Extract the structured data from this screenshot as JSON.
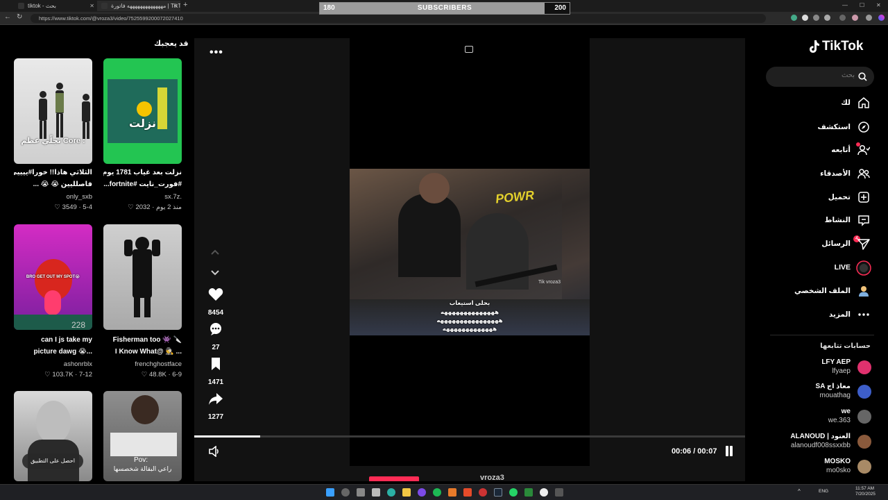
{
  "browser": {
    "tabs": [
      {
        "label": "tiktok - بحث"
      },
      {
        "label": "فاتورة‎ مهههههههههههههه‎ | TikTok"
      }
    ],
    "new_tab_icon": "+",
    "url": "https://www.tiktok.com/@vroza3/video/7525599200072027410",
    "window_controls": {
      "minimize": "—",
      "maximize": "☐",
      "close": "✕"
    }
  },
  "overlay": {
    "current": "180",
    "label": "SUBSCRIBERS",
    "goal": "200",
    "progress_fraction": 0.9
  },
  "recommended": {
    "title": "قد يعجبك",
    "cards": [
      {
        "thumb_text": "تجلّي عظم Core :",
        "caption1": "الثلاثي هاذا!! خورا#ييييي",
        "caption2": "فاصلليين 😭 😭 ...",
        "author": "only_sxb",
        "stats": "♡ 3549 · 5-4"
      },
      {
        "thumb_text": "نزلت",
        "caption1": "نزلت بعد غياب 1781 يوم 😍",
        "caption2": "#فورت_نايت #fortnite...",
        "author": "sx.7z.",
        "stats": "♡ 2032 · منذ 2 يوم"
      },
      {
        "thumb_text": "BRO GET OUT MY SPOT😭",
        "thumb_num": "228",
        "caption1": "can I js take my",
        "caption2": "picture dawg 😭...",
        "author": "ashonrblx",
        "stats": "♡ 103.7K · 7-12"
      },
      {
        "caption1": "Fisherman too 👾 🔪",
        "caption2": "I Know What@ 🕵️ ...",
        "author": "frenchghostface",
        "stats": "♡ 48.8K · 6-9"
      },
      {
        "thumb_text": "احصل على التطبيق"
      },
      {
        "thumb_text": "Pov:",
        "thumb_text2": "راعي البقالة شخصسها"
      }
    ]
  },
  "video": {
    "more_icon": "•••",
    "watermark": "Tik vroza3",
    "subtitle_lines": [
      "بحلى استيعاب",
      "ههههههههههههههه",
      "ههههههههههههههههه",
      "هههههههههههههه"
    ],
    "likes": "8454",
    "comments": "27",
    "saves": "1471",
    "shares": "1277",
    "time": "00:06 / 00:07",
    "progress_fraction": 0.12,
    "author_below": "vroza3"
  },
  "sidebar": {
    "logo": "TikTok",
    "search_placeholder": "بحث",
    "nav": [
      {
        "label": "لك",
        "icon": "home-icon"
      },
      {
        "label": "استكشف",
        "icon": "compass-icon"
      },
      {
        "label": "أتابعه",
        "icon": "following-icon"
      },
      {
        "label": "الأصدقاء",
        "icon": "friends-icon"
      },
      {
        "label": "تحميل",
        "icon": "upload-icon"
      },
      {
        "label": "النشاط",
        "icon": "activity-icon"
      },
      {
        "label": "الرسائل",
        "icon": "messages-icon",
        "badge": "4"
      },
      {
        "label": "LIVE",
        "icon": "live-icon"
      },
      {
        "label": "الملف الشخصي",
        "icon": "profile-icon"
      },
      {
        "label": "المزيد",
        "icon": "more-icon"
      }
    ],
    "following_title": "حسابات تتابعها",
    "following": [
      {
        "name": "LFY AEP",
        "user": "lfyaep",
        "color": "#e0316e"
      },
      {
        "name": "SA معاذ اج",
        "user": "mouathag",
        "color": "#3d5ec9"
      },
      {
        "name": "we",
        "user": "we.363",
        "color": "#666666"
      },
      {
        "name": "ALANOUD | العنود",
        "user": "alanoudf008ssxxbb",
        "color": "#8a5a3c"
      },
      {
        "name": "MOSKO",
        "user": "mo0sko",
        "color": "#a88a66"
      }
    ]
  },
  "taskbar": {
    "lang": "ENG",
    "time": "11:57 AM",
    "date": "7/20/2025"
  }
}
